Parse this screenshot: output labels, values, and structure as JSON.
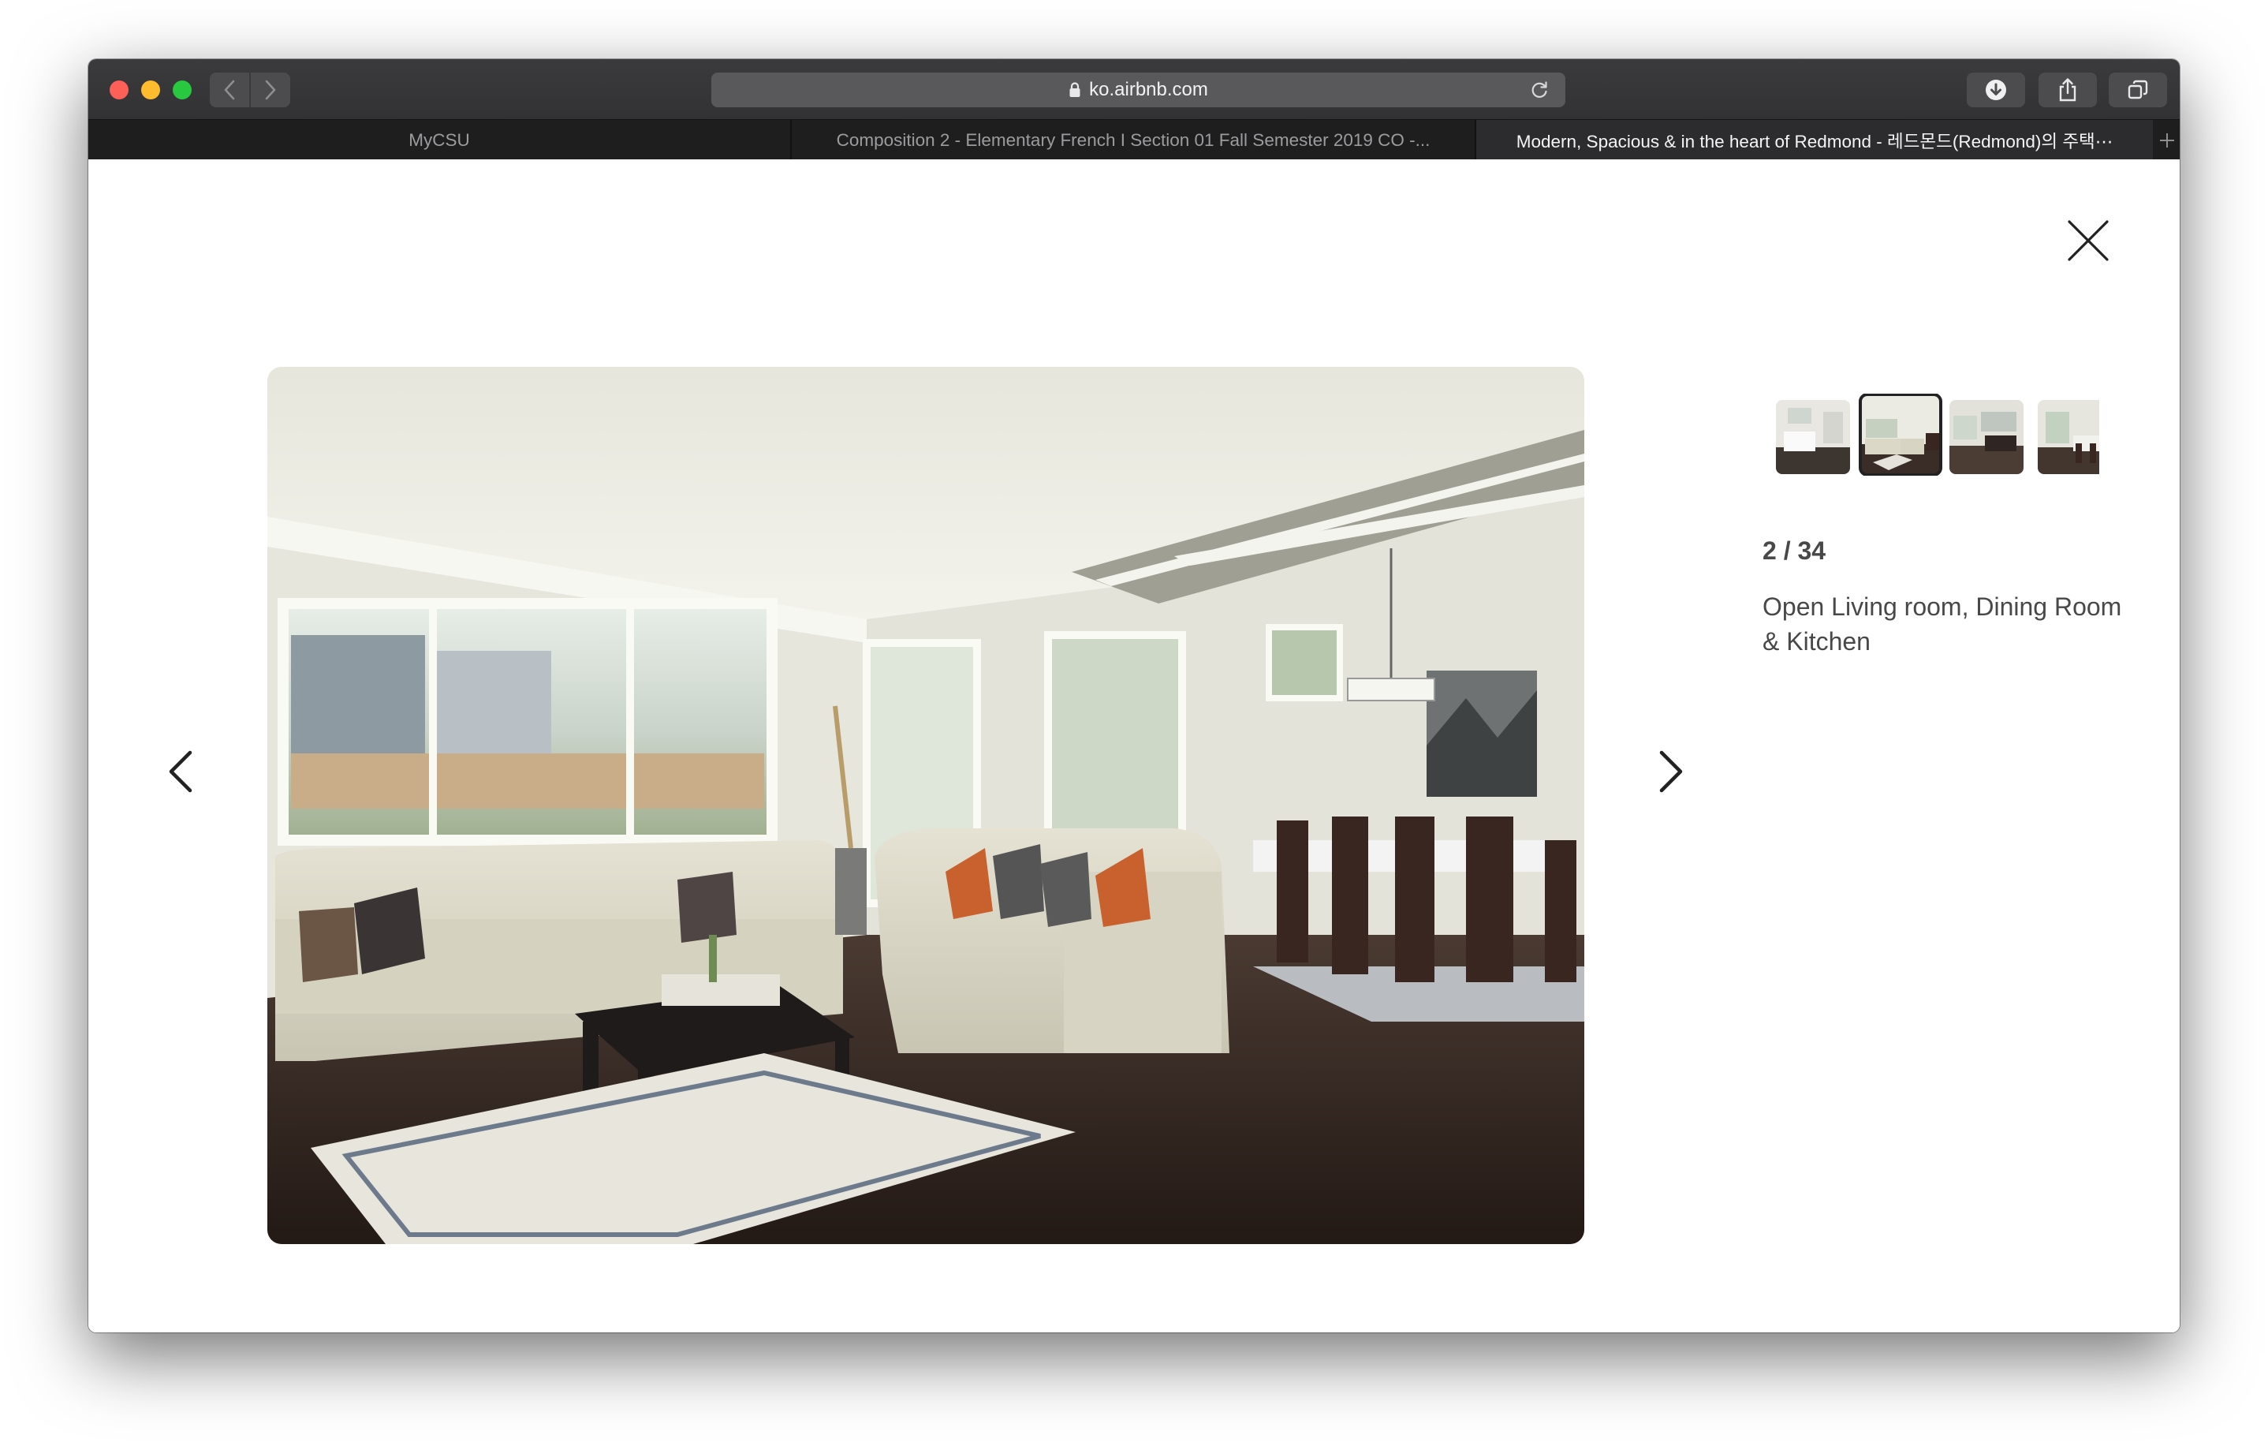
{
  "browser": {
    "url": "ko.airbnb.com",
    "tabs": [
      {
        "label": "MyCSU",
        "active": false
      },
      {
        "label": "Composition 2 - Elementary French I Section 01 Fall Semester 2019 CO -...",
        "active": false
      },
      {
        "label": "Modern, Spacious & in the heart of Redmond - 레드몬드(Redmond)의 주택⋯",
        "active": true
      }
    ],
    "icons": {
      "back": "chevron-left-icon",
      "forward": "chevron-right-icon",
      "lock": "lock-icon",
      "reload": "reload-icon",
      "download": "download-icon",
      "share": "share-icon",
      "tabs_overview": "tabs-overview-icon",
      "new_tab": "plus-icon"
    }
  },
  "gallery": {
    "counter": "2 / 34",
    "caption": "Open Living room, Dining Room & Kitchen",
    "current_index": 2,
    "total": 34,
    "thumbnails": [
      {
        "name": "thumb-kitchen",
        "active": false
      },
      {
        "name": "thumb-living-room",
        "active": true
      },
      {
        "name": "thumb-open-space",
        "active": false
      },
      {
        "name": "thumb-dining",
        "active": false
      }
    ],
    "controls": {
      "close": "close-icon",
      "prev": "chevron-left-icon",
      "next": "chevron-right-icon"
    }
  },
  "colors": {
    "text": "#484848",
    "titlebar": "#343436",
    "tabbar": "#1e1e1f",
    "active_tab": "#2c2c2e"
  }
}
